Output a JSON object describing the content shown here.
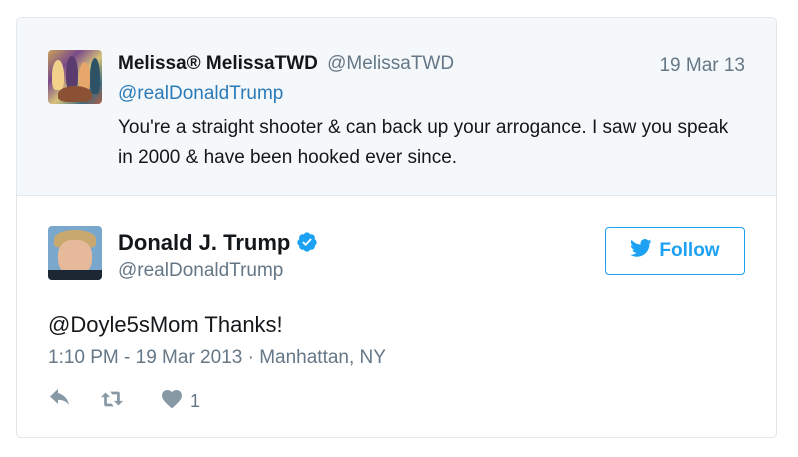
{
  "parent_tweet": {
    "display_name": "Melissa® MelissaTWD",
    "handle": "@MelissaTWD",
    "date": "19 Mar 13",
    "reply_to": "@realDonaldTrump",
    "text": "You're a straight shooter & can back up your arrogance. I saw you speak in 2000 & have been hooked ever since."
  },
  "main_tweet": {
    "display_name": "Donald J. Trump",
    "handle": "@realDonaldTrump",
    "verified": true,
    "follow_label": "Follow",
    "text": "@Doyle5sMom Thanks!",
    "meta": "1:10 PM - 19 Mar 2013 · Manhattan, NY",
    "like_count": "1"
  },
  "icons": [
    "verified-badge-icon",
    "twitter-bird-icon",
    "reply-icon",
    "retweet-icon",
    "heart-icon"
  ],
  "colors": {
    "accent": "#1da1f2",
    "link": "#2b7bb9",
    "muted": "#657786",
    "action_gray": "#8899a6",
    "parent_bg": "#f5f8fa"
  }
}
